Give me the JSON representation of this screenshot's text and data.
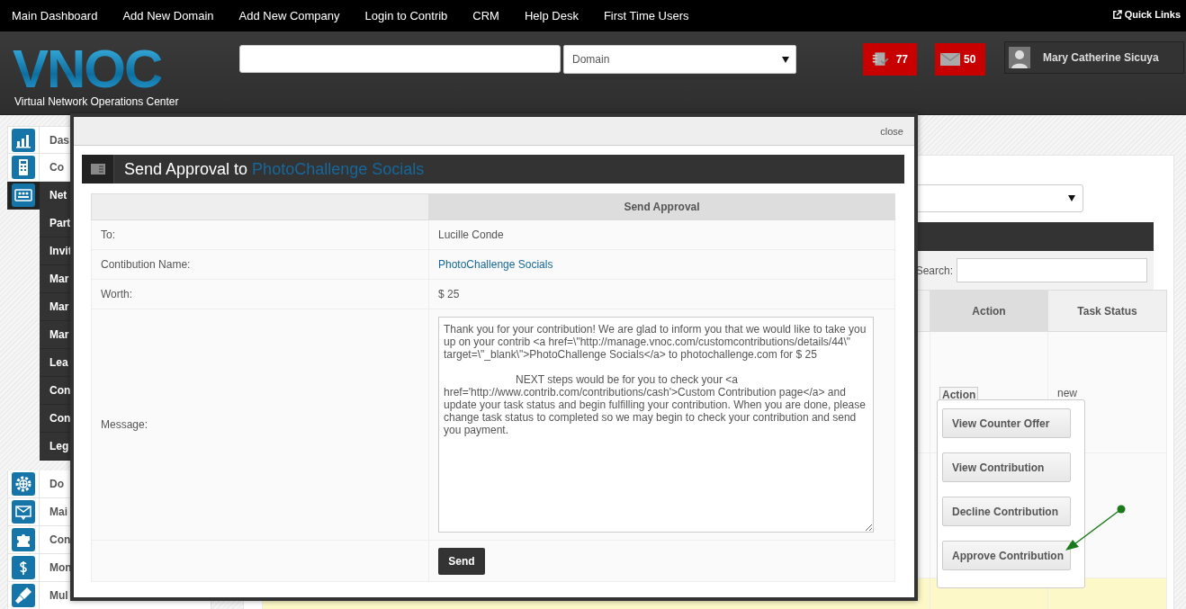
{
  "top_nav": {
    "links": [
      "Main Dashboard",
      "Add New Domain",
      "Add New Company",
      "Login to Contrib",
      "CRM",
      "Help Desk",
      "First Time Users"
    ],
    "quick_links": "Quick Links"
  },
  "header": {
    "logo": "VNOC",
    "logo_subtitle": "Virtual Network Operations Center",
    "domain_select": "Domain",
    "badges": [
      {
        "kind": "tasks",
        "count": "77"
      },
      {
        "kind": "mail",
        "count": "50"
      }
    ],
    "user": {
      "name": "Mary Catherine Sicuya"
    }
  },
  "sidebar": {
    "items": [
      {
        "label": "Das",
        "selected": false
      },
      {
        "label": "Co",
        "selected": false
      },
      {
        "label": "Net",
        "selected": true,
        "children": [
          {
            "label": "Part"
          },
          {
            "label": "Invit"
          },
          {
            "label": "Mar"
          },
          {
            "label": "Mar"
          },
          {
            "label": "Mar"
          },
          {
            "label": "Lea"
          },
          {
            "label": "Con"
          },
          {
            "label": "Con"
          },
          {
            "label": "Leg"
          }
        ]
      },
      {
        "label": "Do",
        "selected": false
      },
      {
        "label": "Mai",
        "selected": false
      },
      {
        "label": "Con",
        "selected": false
      },
      {
        "label": "Mon",
        "selected": false
      },
      {
        "label": "Mul",
        "selected": false
      }
    ]
  },
  "main": {
    "search_label": "Search:",
    "columns": [
      {
        "label": "Action",
        "sorted": true
      },
      {
        "label": "Task Status",
        "sorted": false
      }
    ],
    "rows": [
      {
        "action": "Action",
        "task_status": "new",
        "highlighted": false
      },
      {
        "highlighted": false
      },
      {
        "highlighted": true
      }
    ],
    "action_menu": [
      "View Counter Offer",
      "View Contribution",
      "Decline Contribution",
      "Approve Contribution"
    ]
  },
  "modal": {
    "close": "close",
    "title": "Send Approval to",
    "title_name": "PhotoChallenge Socials",
    "table_heading": "Send Approval",
    "rows": [
      {
        "label": "To:",
        "kind": "text",
        "value": "Lucille Conde"
      },
      {
        "label": "Contibution Name:",
        "kind": "link",
        "value": "PhotoChallenge Socials"
      },
      {
        "label": "Worth:",
        "kind": "text",
        "value": "$ 25"
      },
      {
        "label": "Message:",
        "kind": "textarea",
        "value": "Thank you for your contribution! We are glad to inform you that we would like to take you up on your contrib <a href=\\\"http://manage.vnoc.com/customcontributions/details/44\\\" target=\\\"_blank\\\">PhotoChallenge Socials</a> to photochallenge.com for $ 25\n\n                        NEXT steps would be for you to check your <a href='http://www.contrib.com/contributions/cash'>Custom Contribution page</a> and update your task status and begin fulfilling your contribution. When you are done, please change task status to completed so we may begin to check your contribution and send you payment."
      }
    ],
    "send_button": "Send"
  }
}
